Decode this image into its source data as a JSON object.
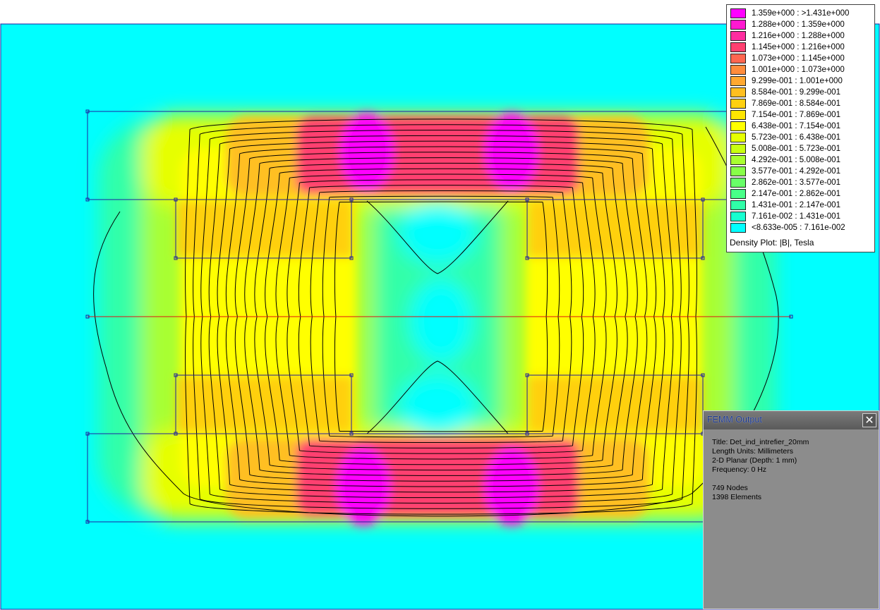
{
  "legend": {
    "title": "Density Plot: |B|, Tesla",
    "entries": [
      {
        "label": "1.359e+000 : >1.431e+000",
        "color": "#ff00ff"
      },
      {
        "label": "1.288e+000 : 1.359e+000",
        "color": "#ff18d0"
      },
      {
        "label": "1.216e+000 : 1.288e+000",
        "color": "#ff2ca0"
      },
      {
        "label": "1.145e+000 : 1.216e+000",
        "color": "#ff4070"
      },
      {
        "label": "1.073e+000 : 1.145e+000",
        "color": "#ff6650"
      },
      {
        "label": "1.001e+000 : 1.073e+000",
        "color": "#ff8c3c"
      },
      {
        "label": "9.299e-001 : 1.001e+000",
        "color": "#ffa830"
      },
      {
        "label": "8.584e-001 : 9.299e-001",
        "color": "#ffbf20"
      },
      {
        "label": "7.869e-001 : 8.584e-001",
        "color": "#ffd010"
      },
      {
        "label": "7.154e-001 : 7.869e-001",
        "color": "#ffe600"
      },
      {
        "label": "6.438e-001 : 7.154e-001",
        "color": "#ffff00"
      },
      {
        "label": "5.723e-001 : 6.438e-001",
        "color": "#e6ff00"
      },
      {
        "label": "5.008e-001 : 5.723e-001",
        "color": "#c8ff10"
      },
      {
        "label": "4.292e-001 : 5.008e-001",
        "color": "#a8ff30"
      },
      {
        "label": "3.577e-001 : 4.292e-001",
        "color": "#88ff48"
      },
      {
        "label": "2.862e-001 : 3.577e-001",
        "color": "#68ff68"
      },
      {
        "label": "2.147e-001 : 2.862e-001",
        "color": "#48ff88"
      },
      {
        "label": "1.431e-001 : 2.147e-001",
        "color": "#30ffa8"
      },
      {
        "label": "7.161e-002 : 1.431e-001",
        "color": "#18ffd0"
      },
      {
        "label": "<8.633e-005 : 7.161e-002",
        "color": "#00ffff"
      }
    ]
  },
  "output": {
    "title": "FEMM Output",
    "lines": [
      "Title: Det_ind_intrefier_20mm",
      "Length Units: Millimeters",
      "2-D Planar (Depth: 1 mm)",
      "Frequency: 0 Hz",
      "",
      "749 Nodes",
      "1398 Elements"
    ]
  },
  "colors": {
    "background": "#00ffff",
    "core_peak": "#ff00ff",
    "boundary": "#1f1fa0",
    "symmetry_line": "#e01010",
    "flux_line": "#000000"
  },
  "icons": {
    "close": "close-icon"
  }
}
